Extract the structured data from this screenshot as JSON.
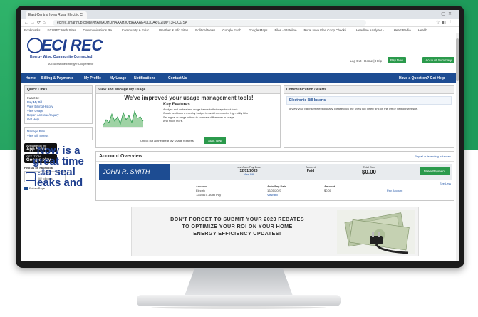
{
  "browser": {
    "tab_title": "East-Central Iowa Rural Electric C",
    "url": "ecirec.smarthub.coop/#HAMAUHUHAAAHJUtqAAAAE4LDCAkIGZiDPT3FDCGSA",
    "bookmarks": [
      "Bookmarks",
      "ECI REC Web Sites",
      "Communications Re...",
      "Community & Educ...",
      "Weather & Info Sites",
      "Political News",
      "Google Earth",
      "Google Maps",
      "Files - Stateline",
      "Rural Iowa Elec Coop Checkli...",
      "Headline Analyzer -...",
      "Heart Radio",
      "Health"
    ]
  },
  "header": {
    "logo_text": "ECI REC",
    "logo_tagline": "Energy Wise, Community Connected",
    "logo_sub": "A Touchstone Energy® Cooperative",
    "links": "Log Out | Home | Help",
    "pay_now": "Pay Now",
    "account_summary": "Account Summary"
  },
  "nav": {
    "items": [
      "Home",
      "Billing & Payments",
      "My Profile",
      "My Usage",
      "Notifications",
      "Contact Us"
    ],
    "help": "Have a Question? Get Help"
  },
  "sidebar": {
    "quick_links_title": "Quick Links",
    "i_want_to": "I want to:",
    "links": [
      "Pay My Bill",
      "View Billing History",
      "View Usage",
      "Report An Issue/Inquiry",
      "Get Help"
    ],
    "links2": [
      "Manage Plan",
      "View Bill Inserts"
    ],
    "app_store_small": "Available on the",
    "app_store": "App Store",
    "google_small": "GET IT ON",
    "google_play": "Google play",
    "facebook_label": "Find us on Facebook",
    "fb_name": "East-Ce...",
    "fb_sub": "862 followers",
    "follow_page": "Follow Page"
  },
  "promo": {
    "line1": "Now is a",
    "line2": "great time",
    "line3": "to seal",
    "line4": "leaks and"
  },
  "view_manage": {
    "title": "View and Manage My Usage",
    "headline": "We've improved your usage management tools!",
    "key_features": "Key Features",
    "features": [
      "Analyze and understand usage trends to find ways to cut back",
      "Create and track a monthly budget to avoid unexpected high utility bills",
      "Set a goal or range in time to compare differences in usage",
      "And much more."
    ],
    "check_text": "Check out all the great My Usage features!",
    "start_now": "Start Now"
  },
  "communication": {
    "title": "Communication / Alerts",
    "subheader": "Electronic Bill Inserts",
    "body": "To view your bill insert electronically, please click the 'View Bill Insert' link on the left or visit our website."
  },
  "account": {
    "title": "Account Overview",
    "pay_all": "Pay all outstanding balances",
    "name": "JOHN R. SMITH",
    "last_auto_pay_label": "Last Auto Pay Date",
    "last_auto_pay_date": "12/01/2023",
    "view_bill": "View Bill",
    "amount_label": "Amount",
    "amount_value": "Paid",
    "total_due_label": "Total Due",
    "total_due": "$0.00",
    "make_payment": "Make Payment",
    "see_less": "See Less",
    "table_headers": [
      "Account",
      "Auto Pay Date",
      "Amount"
    ],
    "row_account": "Electric",
    "row_account_id": "1234567 - Auto Pay",
    "row_date": "12/01/2023",
    "row_view_bill": "View Bill",
    "row_amount": "$0.00",
    "row_pay_account": "Pay Account"
  },
  "banner": {
    "line1": "DON'T FORGET TO SUBMIT YOUR 2023 REBATES",
    "line2": "TO OPTIMIZE YOUR ROI ON YOUR HOME",
    "line3": "ENERGY EFFICIENCY UPDATES!"
  },
  "colors": {
    "brand_blue": "#1d4c92",
    "accent_green": "#2b9a4c",
    "backdrop_green": "#1e9a5a"
  }
}
